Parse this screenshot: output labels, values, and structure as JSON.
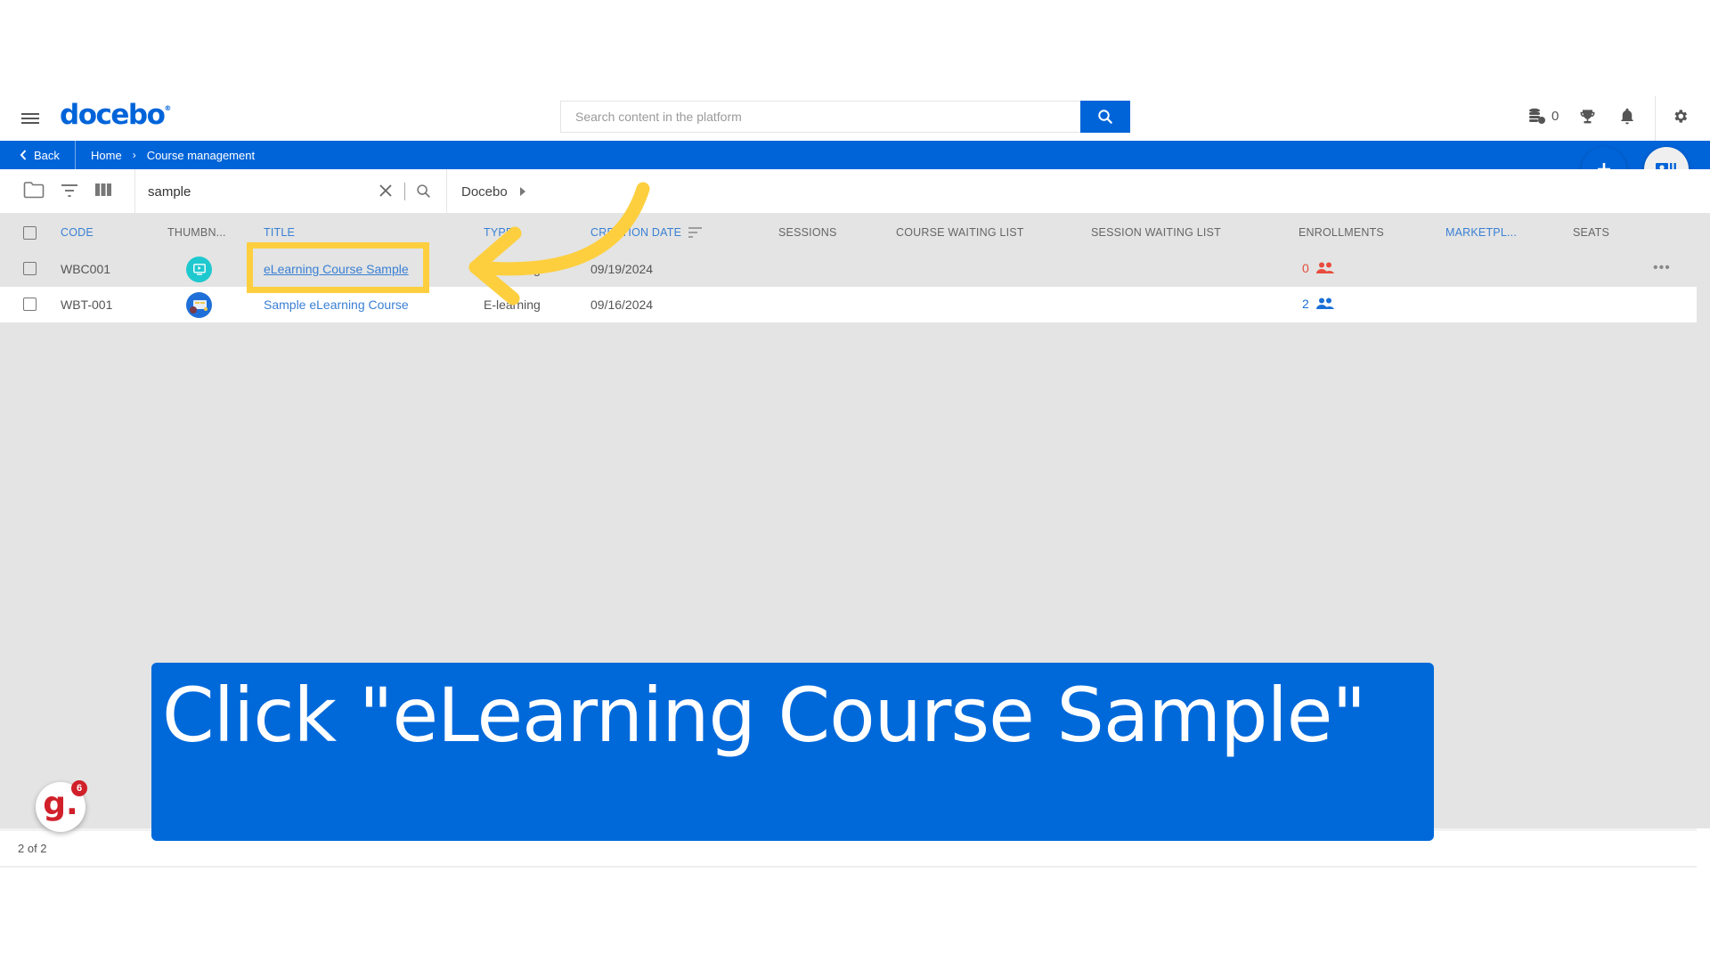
{
  "header": {
    "brand": "docebo",
    "search_placeholder": "Search content in the platform",
    "credits_count": "0"
  },
  "breadcrumb": {
    "back_label": "Back",
    "items": [
      "Home",
      "Course management"
    ],
    "separator": "›"
  },
  "toolbar": {
    "filter_value": "sample",
    "branch_label": "Docebo"
  },
  "table": {
    "columns": {
      "code": "CODE",
      "thumbnail": "THUMBN...",
      "title": "TITLE",
      "type": "TYPE",
      "creation_date": "CREATION DATE",
      "sessions": "SESSIONS",
      "course_waiting_list": "COURSE WAITING LIST",
      "session_waiting_list": "SESSION WAITING LIST",
      "enrollments": "ENROLLMENTS",
      "marketplace": "MARKETPL...",
      "seats": "SEATS"
    },
    "rows": [
      {
        "code": "WBC001",
        "thumbnail_icon": "video-course-icon",
        "title": "eLearning Course Sample",
        "type": "E-learning",
        "creation_date": "09/19/2024",
        "enrollments": "0",
        "enrollments_color": "#e84c3d",
        "more_label": "•••"
      },
      {
        "code": "WBT-001",
        "thumbnail_icon": "course-image-icon",
        "title": "Sample eLearning Course",
        "type": "E-learning",
        "creation_date": "09/16/2024",
        "enrollments": "2",
        "enrollments_color": "#1a6fd6"
      }
    ]
  },
  "pager": {
    "label": "2 of 2"
  },
  "tutorial": {
    "caption": "Click \"eLearning Course Sample\"",
    "highlight_color": "#fdcf3f",
    "guide_badge_count": "6",
    "guide_letter": "g."
  },
  "colors": {
    "brand_blue": "#0064d9",
    "grid_bg": "#e3e4e3"
  }
}
